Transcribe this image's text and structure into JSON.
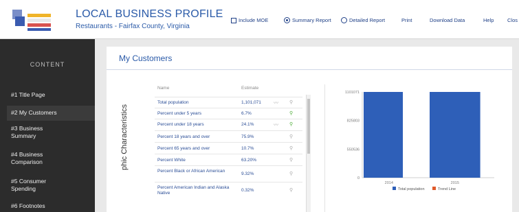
{
  "header": {
    "title": "LOCAL BUSINESS PROFILE",
    "subtitle": "Restaurants - Fairfax County, Virginia",
    "nav": {
      "include_moe": "Include MOE",
      "summary_report": "Summary Report",
      "detailed_report": "Detailed Report",
      "print": "Print",
      "download": "Download Data",
      "help": "Help",
      "close": "Clos"
    }
  },
  "sidebar": {
    "heading": "CONTENT",
    "items": [
      {
        "label": "#1 Title Page"
      },
      {
        "label": "#2 My Customers"
      },
      {
        "label": "#3 Business Summary"
      },
      {
        "label": "#4 Business Comparison"
      },
      {
        "label": "#5 Consumer Spending"
      },
      {
        "label": "#6 Footnotes"
      }
    ]
  },
  "main": {
    "title": "My Customers",
    "section_label": "phic Characteristics",
    "table": {
      "headers": {
        "name": "Name",
        "estimate": "Estimate"
      },
      "rows": [
        {
          "name": "Total population",
          "estimate": "1,101,071",
          "pin": "gray"
        },
        {
          "name": "Percent under 5 years",
          "estimate": "6.7%",
          "pin": "green"
        },
        {
          "name": "Percent under 18 years",
          "estimate": "24.1%",
          "pin": "green"
        },
        {
          "name": "Percent 18 years and over",
          "estimate": "75.9%",
          "pin": "gray"
        },
        {
          "name": "Percent 65 years and over",
          "estimate": "10.7%",
          "pin": "gray"
        },
        {
          "name": "Percent White",
          "estimate": "63.20%",
          "pin": "gray"
        },
        {
          "name": "Percent Black or African American",
          "estimate": "9.32%",
          "pin": "gray"
        },
        {
          "name": "Percent American Indian and Alaska Native",
          "estimate": "0.32%",
          "pin": "gray"
        }
      ]
    }
  },
  "chart_data": {
    "type": "bar",
    "categories": [
      "2014",
      "2015"
    ],
    "series": [
      {
        "name": "Total population",
        "values": [
          1101071,
          1101071
        ],
        "color": "#2e5fb8"
      }
    ],
    "trend_label": "Trend Line",
    "trend_color": "#e05a2a",
    "yticks": [
      "1101071",
      "825803",
      "550536",
      "0"
    ],
    "ylim": [
      0,
      1101071
    ],
    "legend": "bottom"
  }
}
